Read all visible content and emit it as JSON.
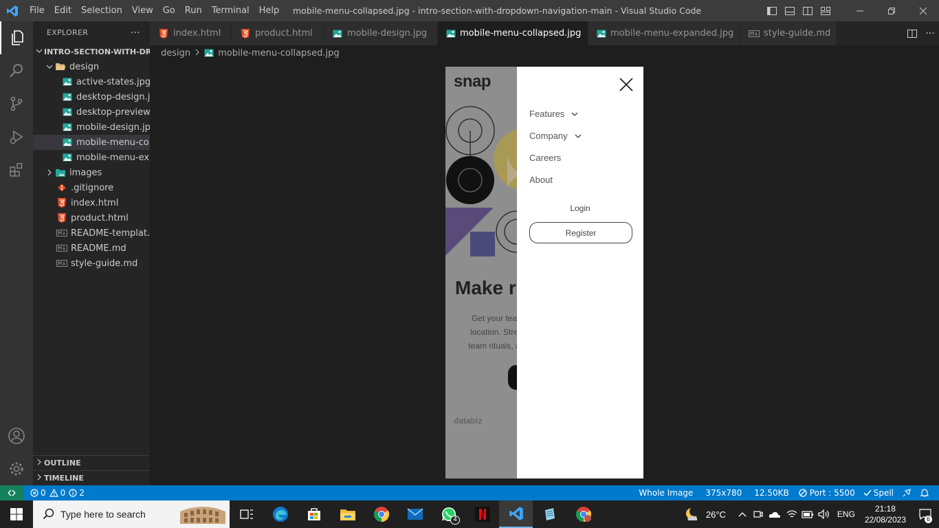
{
  "titlebar": {
    "menu": [
      "File",
      "Edit",
      "Selection",
      "View",
      "Go",
      "Run",
      "Terminal",
      "Help"
    ],
    "window_title": "mobile-menu-collapsed.jpg - intro-section-with-dropdown-navigation-main - Visual Studio Code"
  },
  "explorer": {
    "header": "EXPLORER",
    "project": "INTRO-SECTION-WITH-DR...",
    "tree": [
      {
        "label": "design",
        "type": "folder-open"
      },
      {
        "label": "active-states.jpg",
        "type": "image"
      },
      {
        "label": "desktop-design.j...",
        "type": "image"
      },
      {
        "label": "desktop-preview....",
        "type": "image"
      },
      {
        "label": "mobile-design.jpg",
        "type": "image"
      },
      {
        "label": "mobile-menu-co...",
        "type": "image",
        "selected": true
      },
      {
        "label": "mobile-menu-ex...",
        "type": "image"
      },
      {
        "label": "images",
        "type": "folder-closed"
      },
      {
        "label": ".gitignore",
        "type": "git"
      },
      {
        "label": "index.html",
        "type": "html"
      },
      {
        "label": "product.html",
        "type": "html"
      },
      {
        "label": "README-templat...",
        "type": "md"
      },
      {
        "label": "README.md",
        "type": "md"
      },
      {
        "label": "style-guide.md",
        "type": "md"
      }
    ],
    "outline": "OUTLINE",
    "timeline": "TIMELINE"
  },
  "tabs": [
    {
      "label": "index.html",
      "type": "html"
    },
    {
      "label": "product.html",
      "type": "html"
    },
    {
      "label": "mobile-design.jpg",
      "type": "image"
    },
    {
      "label": "mobile-menu-collapsed.jpg",
      "type": "image",
      "active": true
    },
    {
      "label": "mobile-menu-expanded.jpg",
      "type": "image"
    },
    {
      "label": "style-guide.md",
      "type": "md"
    }
  ],
  "breadcrumb": {
    "folder": "design",
    "file": "mobile-menu-collapsed.jpg"
  },
  "preview": {
    "logo": "snap",
    "headline": "Make r",
    "body_lines": [
      "Get your tea",
      "location. Stre",
      "team rituals, a"
    ],
    "client": "databiz",
    "nav": [
      "Features",
      "Company",
      "Careers",
      "About"
    ],
    "login": "Login",
    "register": "Register"
  },
  "statusbar": {
    "errors": "0",
    "warnings": "0",
    "info": "2",
    "view_mode": "Whole Image",
    "dimensions": "375x780",
    "file_size": "12.50KB",
    "port": "Port : 5500",
    "spell": "Spell"
  },
  "taskbar": {
    "search_placeholder": "Type here to search",
    "whatsapp_badge": "4",
    "temperature": "26°C",
    "language": "ENG",
    "time": "21:18",
    "date": "22/08/2023",
    "notifications": "6"
  },
  "colors": {
    "statusbar": "#007acc",
    "remote": "#16825d",
    "titlebar": "#3c3c3c",
    "activity": "#333333",
    "sidebar": "#252526",
    "editor": "#1e1e1e"
  }
}
